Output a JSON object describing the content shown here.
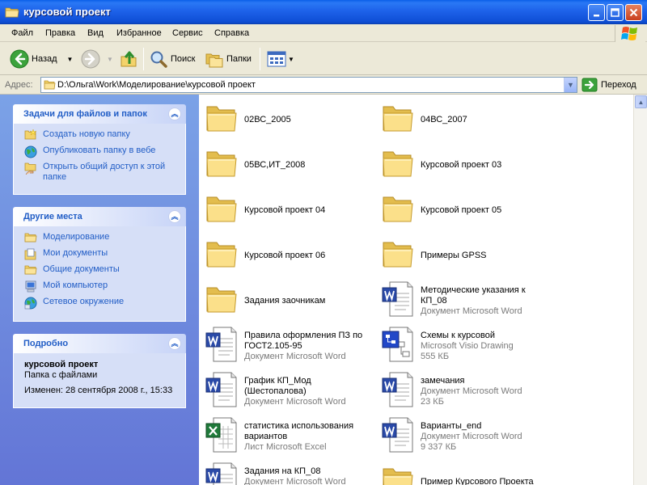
{
  "window": {
    "title": "курсовой проект"
  },
  "menubar": {
    "items": [
      "Файл",
      "Правка",
      "Вид",
      "Избранное",
      "Сервис",
      "Справка"
    ]
  },
  "toolbar": {
    "back_label": "Назад",
    "search_label": "Поиск",
    "folders_label": "Папки"
  },
  "address": {
    "label": "Адрес:",
    "path": "D:\\Ольга\\Work\\Моделирование\\курсовой проект",
    "go_label": "Переход"
  },
  "tasks_panel": {
    "title": "Задачи для файлов и папок",
    "items": [
      {
        "label": "Создать новую папку",
        "icon": "new-folder-icon"
      },
      {
        "label": "Опубликовать папку в вебе",
        "icon": "web-publish-icon"
      },
      {
        "label": "Открыть общий доступ к этой папке",
        "icon": "share-folder-icon"
      }
    ]
  },
  "places_panel": {
    "title": "Другие места",
    "items": [
      {
        "label": "Моделирование",
        "icon": "folder-icon"
      },
      {
        "label": "Мои документы",
        "icon": "my-documents-icon"
      },
      {
        "label": "Общие документы",
        "icon": "shared-documents-icon"
      },
      {
        "label": "Мой компьютер",
        "icon": "my-computer-icon"
      },
      {
        "label": "Сетевое окружение",
        "icon": "network-icon"
      }
    ]
  },
  "details_panel": {
    "title": "Подробно",
    "name": "курсовой проект",
    "type": "Папка с файлами",
    "modified": "Изменен: 28 сентября 2008 г., 15:33"
  },
  "files": [
    {
      "name": "02ВС_2005",
      "type": "",
      "size": "",
      "icon": "folder"
    },
    {
      "name": "04ВС_2007",
      "type": "",
      "size": "",
      "icon": "folder"
    },
    {
      "name": "05ВС,ИТ_2008",
      "type": "",
      "size": "",
      "icon": "folder"
    },
    {
      "name": "Курсовой проект 03",
      "type": "",
      "size": "",
      "icon": "folder"
    },
    {
      "name": "Курсовой проект 04",
      "type": "",
      "size": "",
      "icon": "folder"
    },
    {
      "name": "Курсовой проект 05",
      "type": "",
      "size": "",
      "icon": "folder"
    },
    {
      "name": "Курсовой проект 06",
      "type": "",
      "size": "",
      "icon": "folder"
    },
    {
      "name": "Примеры GPSS",
      "type": "",
      "size": "",
      "icon": "folder"
    },
    {
      "name": "Задания заочникам",
      "type": "",
      "size": "",
      "icon": "folder"
    },
    {
      "name": "Методические указания к КП_08",
      "type": "Документ Microsoft Word",
      "size": "",
      "icon": "word"
    },
    {
      "name": "Правила оформления ПЗ по ГОСТ2.105-95",
      "type": "Документ Microsoft Word",
      "size": "",
      "icon": "word"
    },
    {
      "name": "Схемы к курсовой",
      "type": "Microsoft Visio Drawing",
      "size": "555 КБ",
      "icon": "visio"
    },
    {
      "name": "График КП_Мод (Шестопалова)",
      "type": "Документ Microsoft Word",
      "size": "",
      "icon": "word"
    },
    {
      "name": "замечания",
      "type": "Документ Microsoft Word",
      "size": "23 КБ",
      "icon": "word"
    },
    {
      "name": "статистика использования вариантов",
      "type": "Лист Microsoft Excel",
      "size": "",
      "icon": "excel"
    },
    {
      "name": "Варианты_end",
      "type": "Документ Microsoft Word",
      "size": "9 337 КБ",
      "icon": "word"
    },
    {
      "name": "Задания на КП_08",
      "type": "Документ Microsoft Word",
      "size": "",
      "icon": "word"
    },
    {
      "name": "Пример Курсового Проекта",
      "type": "",
      "size": "",
      "icon": "folder"
    }
  ],
  "colors": {
    "titlebar": "#0a5fe8",
    "task_link": "#215dc6",
    "panel_bg": "#d6dff7",
    "sidebar_bg": "#7ba2e7"
  }
}
